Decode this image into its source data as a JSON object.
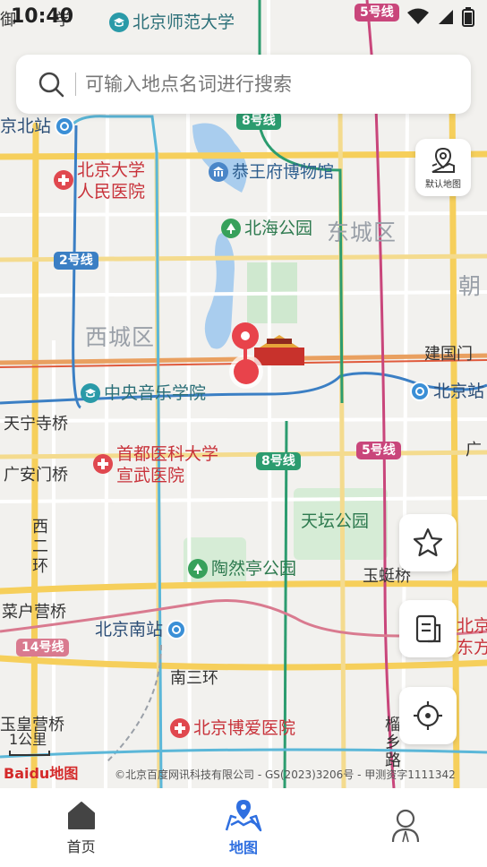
{
  "status_bar": {
    "time": "10:40"
  },
  "search": {
    "placeholder": "可输入地点名词进行搜索"
  },
  "map": {
    "districts": {
      "xicheng": "西城区",
      "dongcheng": "东城区",
      "chaoyang_partial": "朝"
    },
    "pois": {
      "bnu": "北京师范大学",
      "pku_people_hospital": "北京大学\n人民医院",
      "prince_gong_museum": "恭王府博物馆",
      "beihai_park": "北海公园",
      "central_conservatory": "中央音乐学院",
      "xuanwu_hospital": "首都医科大学\n宣武医院",
      "temple_of_heaven": "天坛公园",
      "taoranting_park": "陶然亭公园",
      "beijing_south_station": "北京南站",
      "boai_hospital": "北京博爱医院",
      "beijing_north_station": "京北站",
      "beijing_station": "北京站",
      "partial_right_hospital": "北京\n东方"
    },
    "streets": {
      "tianningsi_bridge": "天宁寺桥",
      "guanganmen_bridge": "广安门桥",
      "xi_er_huan": "西\n二\n环",
      "caihuying_bridge": "菜户营桥",
      "yuhuangying_bridge": "玉皇营桥",
      "jianguomen": "建国门",
      "yuting_bridge": "玉蜓桥",
      "nan_san_huan": "南三环",
      "dongfang": "广",
      "chengxiang_road": "榴\n乡\n路",
      "top_left_partial": "御",
      "top_left_partial2": "学"
    },
    "subway_badges": {
      "line8_top": "8号线",
      "line2": "2号线",
      "line5_top": "5号线",
      "line8_mid": "8号线",
      "line5_mid": "5号线",
      "line14": "14号线"
    },
    "scale_label": "1公里",
    "logo_text": "Baidu地图",
    "copyright": "©北京百度网讯科技有限公司 - GS(2023)3206号 - 甲测资字1111342"
  },
  "buttons": {
    "default_map": "默认地图"
  },
  "tabs": [
    {
      "label": "首页"
    },
    {
      "label": "地图"
    },
    {
      "label": ""
    }
  ],
  "colors": {
    "accent": "#2f6fe0",
    "marker": "#e8434b",
    "line2": "#3b7fc4",
    "line8": "#2c9c6f",
    "line5": "#c9467b",
    "line14": "#d97a8f"
  }
}
